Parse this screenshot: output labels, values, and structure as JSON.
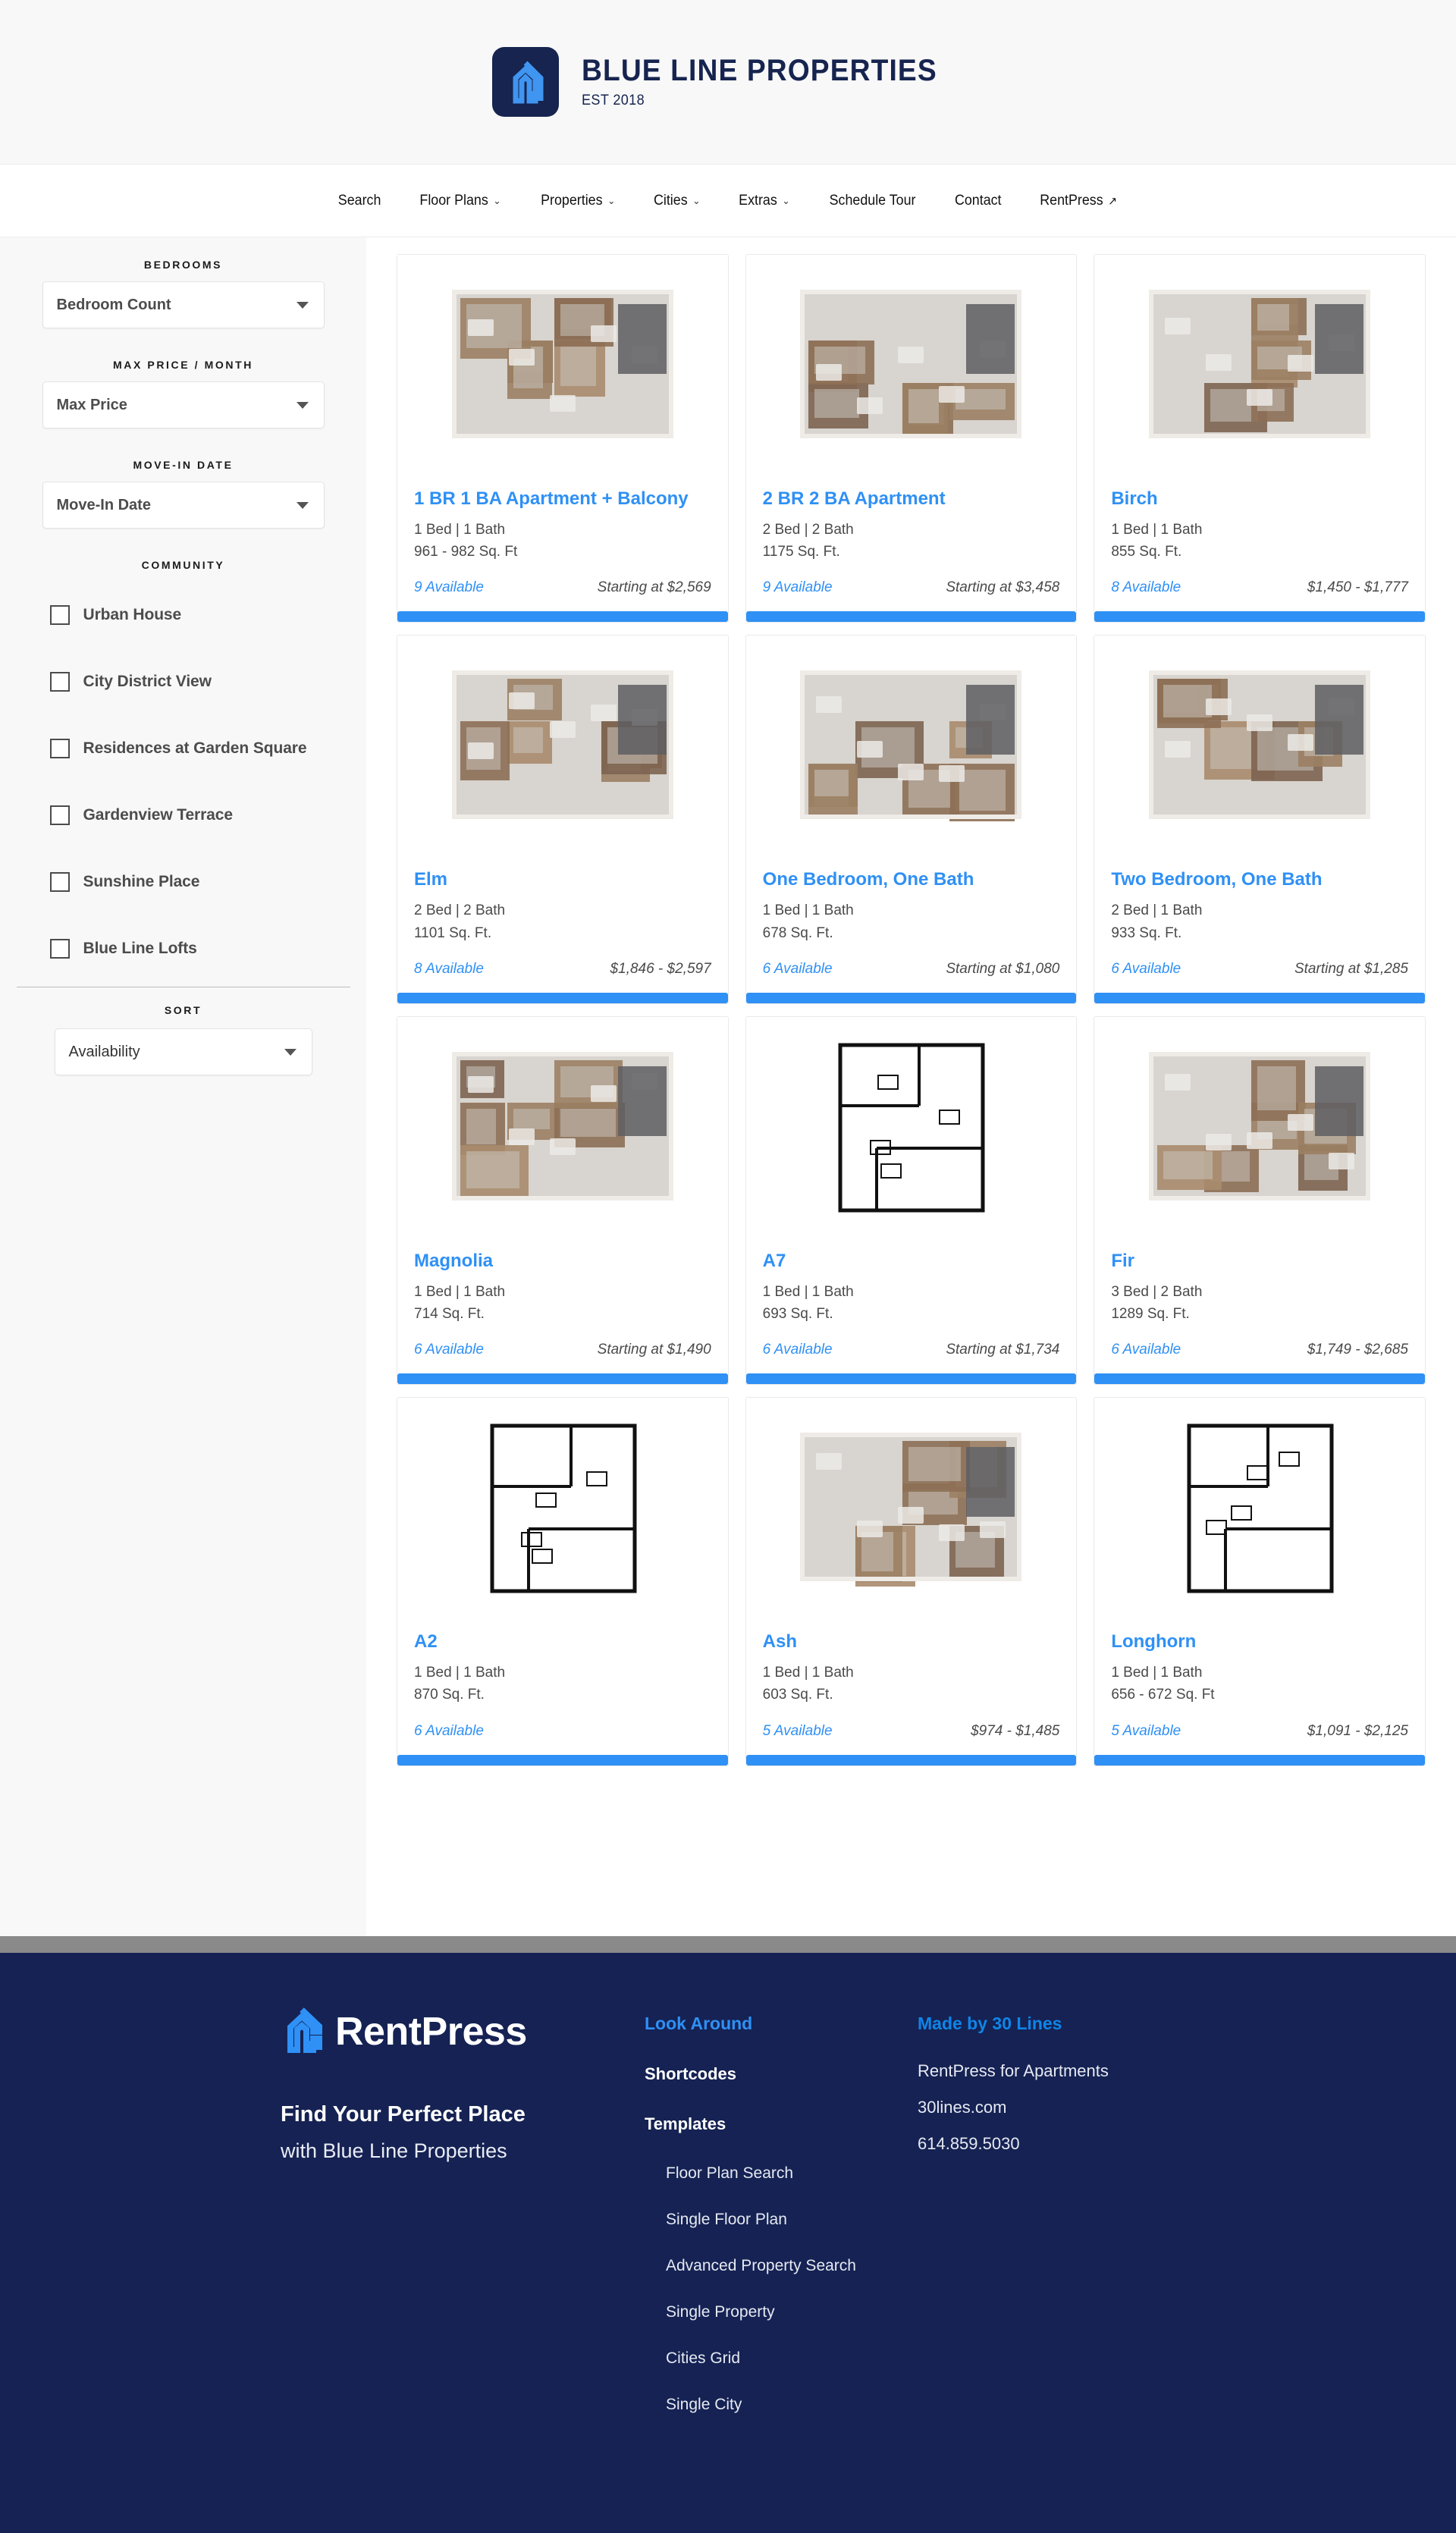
{
  "header": {
    "logo_icon": "house-logo-icon",
    "title": "BLUE LINE PROPERTIES",
    "subtitle": "EST 2018"
  },
  "nav": {
    "items": [
      {
        "label": "Search",
        "has_caret": false,
        "external": false
      },
      {
        "label": "Floor Plans",
        "has_caret": true,
        "external": false
      },
      {
        "label": "Properties",
        "has_caret": true,
        "external": false
      },
      {
        "label": "Cities",
        "has_caret": true,
        "external": false
      },
      {
        "label": "Extras",
        "has_caret": true,
        "external": false
      },
      {
        "label": "Schedule Tour",
        "has_caret": false,
        "external": false
      },
      {
        "label": "Contact",
        "has_caret": false,
        "external": false
      },
      {
        "label": "RentPress",
        "has_caret": false,
        "external": true
      }
    ]
  },
  "sidebar": {
    "bedrooms_label": "BEDROOMS",
    "bedrooms_value": "Bedroom Count",
    "max_price_label": "MAX PRICE / MONTH",
    "max_price_value": "Max Price",
    "move_in_label": "MOVE-IN DATE",
    "move_in_value": "Move-In Date",
    "community_label": "COMMUNITY",
    "communities": [
      {
        "label": "Urban House",
        "checked": false
      },
      {
        "label": "City District View",
        "checked": false
      },
      {
        "label": "Residences at Garden Square",
        "checked": false
      },
      {
        "label": "Gardenview Terrace",
        "checked": false
      },
      {
        "label": "Sunshine Place",
        "checked": false
      },
      {
        "label": "Blue Line Lofts",
        "checked": false
      }
    ],
    "sort_label": "SORT",
    "sort_value": "Availability"
  },
  "results": {
    "cards": [
      {
        "title": "1 BR 1 BA Apartment + Balcony",
        "beds": "1 Bed | 1 Bath",
        "sqft": "961 - 982 Sq. Ft",
        "available": "9 Available",
        "price": "Starting at $2,569",
        "image": "floorplan-3d-render"
      },
      {
        "title": "2 BR 2 BA Apartment",
        "beds": "2 Bed | 2 Bath",
        "sqft": "1175 Sq. Ft.",
        "available": "9 Available",
        "price": "Starting at $3,458",
        "image": "floorplan-3d-render"
      },
      {
        "title": "Birch",
        "beds": "1 Bed | 1 Bath",
        "sqft": "855 Sq. Ft.",
        "available": "8 Available",
        "price": "$1,450 - $1,777",
        "image": "floorplan-3d-render"
      },
      {
        "title": "Elm",
        "beds": "2 Bed | 2 Bath",
        "sqft": "1101 Sq. Ft.",
        "available": "8 Available",
        "price": "$1,846 - $2,597",
        "image": "floorplan-3d-render"
      },
      {
        "title": "One Bedroom, One Bath",
        "beds": "1 Bed | 1 Bath",
        "sqft": "678 Sq. Ft.",
        "available": "6 Available",
        "price": "Starting at $1,080",
        "image": "floorplan-3d-render"
      },
      {
        "title": "Two Bedroom, One Bath",
        "beds": "2 Bed | 1 Bath",
        "sqft": "933 Sq. Ft.",
        "available": "6 Available",
        "price": "Starting at $1,285",
        "image": "floorplan-3d-render"
      },
      {
        "title": "Magnolia",
        "beds": "1 Bed | 1 Bath",
        "sqft": "714 Sq. Ft.",
        "available": "6 Available",
        "price": "Starting at $1,490",
        "image": "floorplan-3d-render"
      },
      {
        "title": "A7",
        "beds": "1 Bed | 1 Bath",
        "sqft": "693 Sq. Ft.",
        "available": "6 Available",
        "price": "Starting at $1,734",
        "image": "floorplan-line-drawing"
      },
      {
        "title": "Fir",
        "beds": "3 Bed | 2 Bath",
        "sqft": "1289 Sq. Ft.",
        "available": "6 Available",
        "price": "$1,749 - $2,685",
        "image": "floorplan-3d-render"
      },
      {
        "title": "A2",
        "beds": "1 Bed | 1 Bath",
        "sqft": "870 Sq. Ft.",
        "available": "6 Available",
        "price": "",
        "image": "floorplan-line-drawing"
      },
      {
        "title": "Ash",
        "beds": "1 Bed | 1 Bath",
        "sqft": "603 Sq. Ft.",
        "available": "5 Available",
        "price": "$974 - $1,485",
        "image": "floorplan-3d-render"
      },
      {
        "title": "Longhorn",
        "beds": "1 Bed | 1 Bath",
        "sqft": "656 - 672 Sq. Ft",
        "available": "5 Available",
        "price": "$1,091 - $2,125",
        "image": "floorplan-line-drawing"
      }
    ]
  },
  "footer": {
    "logo_word": "RentPress",
    "logo_icon": "rentpress-house-icon",
    "tagline_1": "Find Your Perfect Place",
    "tagline_2": "with Blue Line Properties",
    "look_around_head": "Look Around",
    "shortcodes_label": "Shortcodes",
    "templates_label": "Templates",
    "template_links": [
      "Floor Plan Search",
      "Single Floor Plan",
      "Advanced Property Search",
      "Single Property",
      "Cities Grid",
      "Single City"
    ],
    "made_by_head": "Made by 30 Lines",
    "made_by_lines": [
      "RentPress for Apartments",
      "30lines.com",
      "614.859.5030"
    ]
  },
  "colors": {
    "accent_blue": "#2f90f5",
    "brand_navy": "#152253",
    "sidebar_bg": "#f8f8f8"
  }
}
